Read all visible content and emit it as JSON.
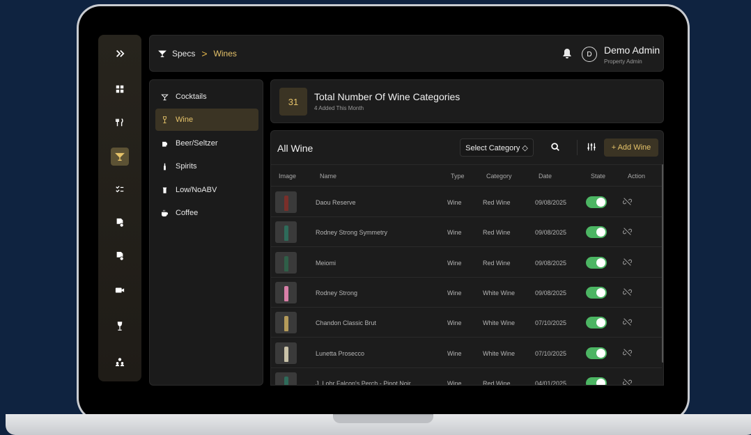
{
  "breadcrumb": {
    "parent": "Specs",
    "separator": ">",
    "current": "Wines"
  },
  "user": {
    "avatar_letter": "D",
    "name": "Demo Admin",
    "role": "Property Admin"
  },
  "rail": {
    "expand_label": ">>",
    "items": [
      {
        "icon": "dashboard-icon"
      },
      {
        "icon": "utensils-icon"
      },
      {
        "icon": "cocktail-icon",
        "active": true
      },
      {
        "icon": "checklist-icon"
      },
      {
        "icon": "document-gear-icon"
      },
      {
        "icon": "document-settings-icon"
      },
      {
        "icon": "video-icon"
      },
      {
        "icon": "wine-glass-icon"
      },
      {
        "icon": "users-icon"
      }
    ]
  },
  "categories": [
    {
      "label": "Cocktails",
      "icon": "cocktail-icon"
    },
    {
      "label": "Wine",
      "icon": "wine-glass-icon",
      "active": true
    },
    {
      "label": "Beer/Seltzer",
      "icon": "beer-icon"
    },
    {
      "label": "Spirits",
      "icon": "bottle-icon"
    },
    {
      "label": "Low/NoABV",
      "icon": "can-icon"
    },
    {
      "label": "Coffee",
      "icon": "coffee-icon"
    }
  ],
  "stat": {
    "count": "31",
    "title": "Total Number Of Wine Categories",
    "subtitle": "4 Added This Month"
  },
  "table": {
    "title": "All Wine",
    "select_category": "Select Category ◇",
    "add_button": "+ Add Wine",
    "columns": [
      "Image",
      "Name",
      "Type",
      "Category",
      "Date",
      "State",
      "Action"
    ],
    "rows": [
      {
        "name": "Daou Reserve",
        "type": "Wine",
        "category": "Red Wine",
        "date": "09/08/2025",
        "state": true,
        "bottle_color": "#7a2f2a"
      },
      {
        "name": "Rodney Strong Symmetry",
        "type": "Wine",
        "category": "Red Wine",
        "date": "09/08/2025",
        "state": true,
        "bottle_color": "#2e6b5a"
      },
      {
        "name": "Meiomi",
        "type": "Wine",
        "category": "Red Wine",
        "date": "09/08/2025",
        "state": true,
        "bottle_color": "#2f5f48"
      },
      {
        "name": "Rodney Strong",
        "type": "Wine",
        "category": "White Wine",
        "date": "09/08/2025",
        "state": true,
        "bottle_color": "#d97fa8"
      },
      {
        "name": "Chandon Classic Brut",
        "type": "Wine",
        "category": "White Wine",
        "date": "07/10/2025",
        "state": true,
        "bottle_color": "#b59b5a"
      },
      {
        "name": "Lunetta Prosecco",
        "type": "Wine",
        "category": "White Wine",
        "date": "07/10/2025",
        "state": true,
        "bottle_color": "#c9c2a8"
      },
      {
        "name": "J. Lohr Falcon's Perch - Pinot Noir",
        "type": "Wine",
        "category": "Red Wine",
        "date": "04/01/2025",
        "state": true,
        "bottle_color": "#2e6b5a"
      }
    ]
  }
}
